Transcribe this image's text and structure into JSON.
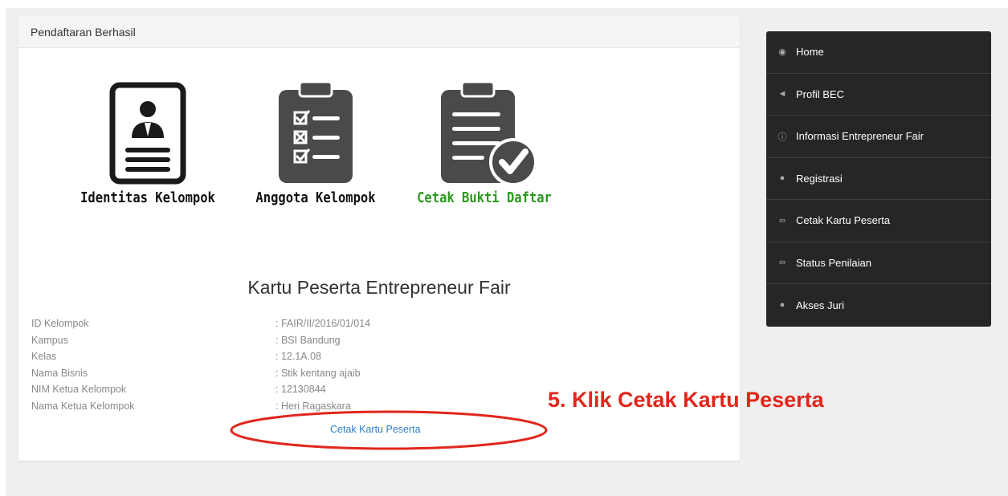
{
  "panel": {
    "title": "Pendaftaran Berhasil"
  },
  "steps": [
    {
      "label": "Identitas Kelompok",
      "icon": "id-card-icon"
    },
    {
      "label": "Anggota Kelompok",
      "icon": "checklist-clipboard-icon"
    },
    {
      "label": "Cetak Bukti Daftar",
      "icon": "clipboard-check-icon",
      "color": "#2a9a1c"
    }
  ],
  "card": {
    "title": "Kartu Peserta Entrepreneur Fair",
    "rows": [
      {
        "label": "ID Kelompok",
        "value": ": FAIR/II/2016/01/014"
      },
      {
        "label": "Kampus",
        "value": ": BSI Bandung"
      },
      {
        "label": "Kelas",
        "value": ": 12.1A.08"
      },
      {
        "label": "Nama Bisnis",
        "value": ": Stik kentang ajaib"
      },
      {
        "label": "NIM Ketua Kelompok",
        "value": ": 12130844"
      },
      {
        "label": "Nama Ketua Kelompok",
        "value": ": Heri Ragaskara"
      }
    ],
    "print_link": "Cetak Kartu Peserta"
  },
  "annotation": {
    "text": "5. Klik Cetak Kartu Peserta",
    "color": "#e1261c"
  },
  "sidebar": {
    "items": [
      {
        "label": "Home",
        "icon": "dashboard-icon"
      },
      {
        "label": "Profil BEC",
        "icon": "megaphone-icon"
      },
      {
        "label": "Informasi Entrepreneur Fair",
        "icon": "info-icon"
      },
      {
        "label": "Registrasi",
        "icon": "user-icon"
      },
      {
        "label": "Cetak Kartu Peserta",
        "icon": "link-icon"
      },
      {
        "label": "Status Penilaian",
        "icon": "link-icon"
      },
      {
        "label": "Akses Juri",
        "icon": "user-icon"
      }
    ]
  }
}
